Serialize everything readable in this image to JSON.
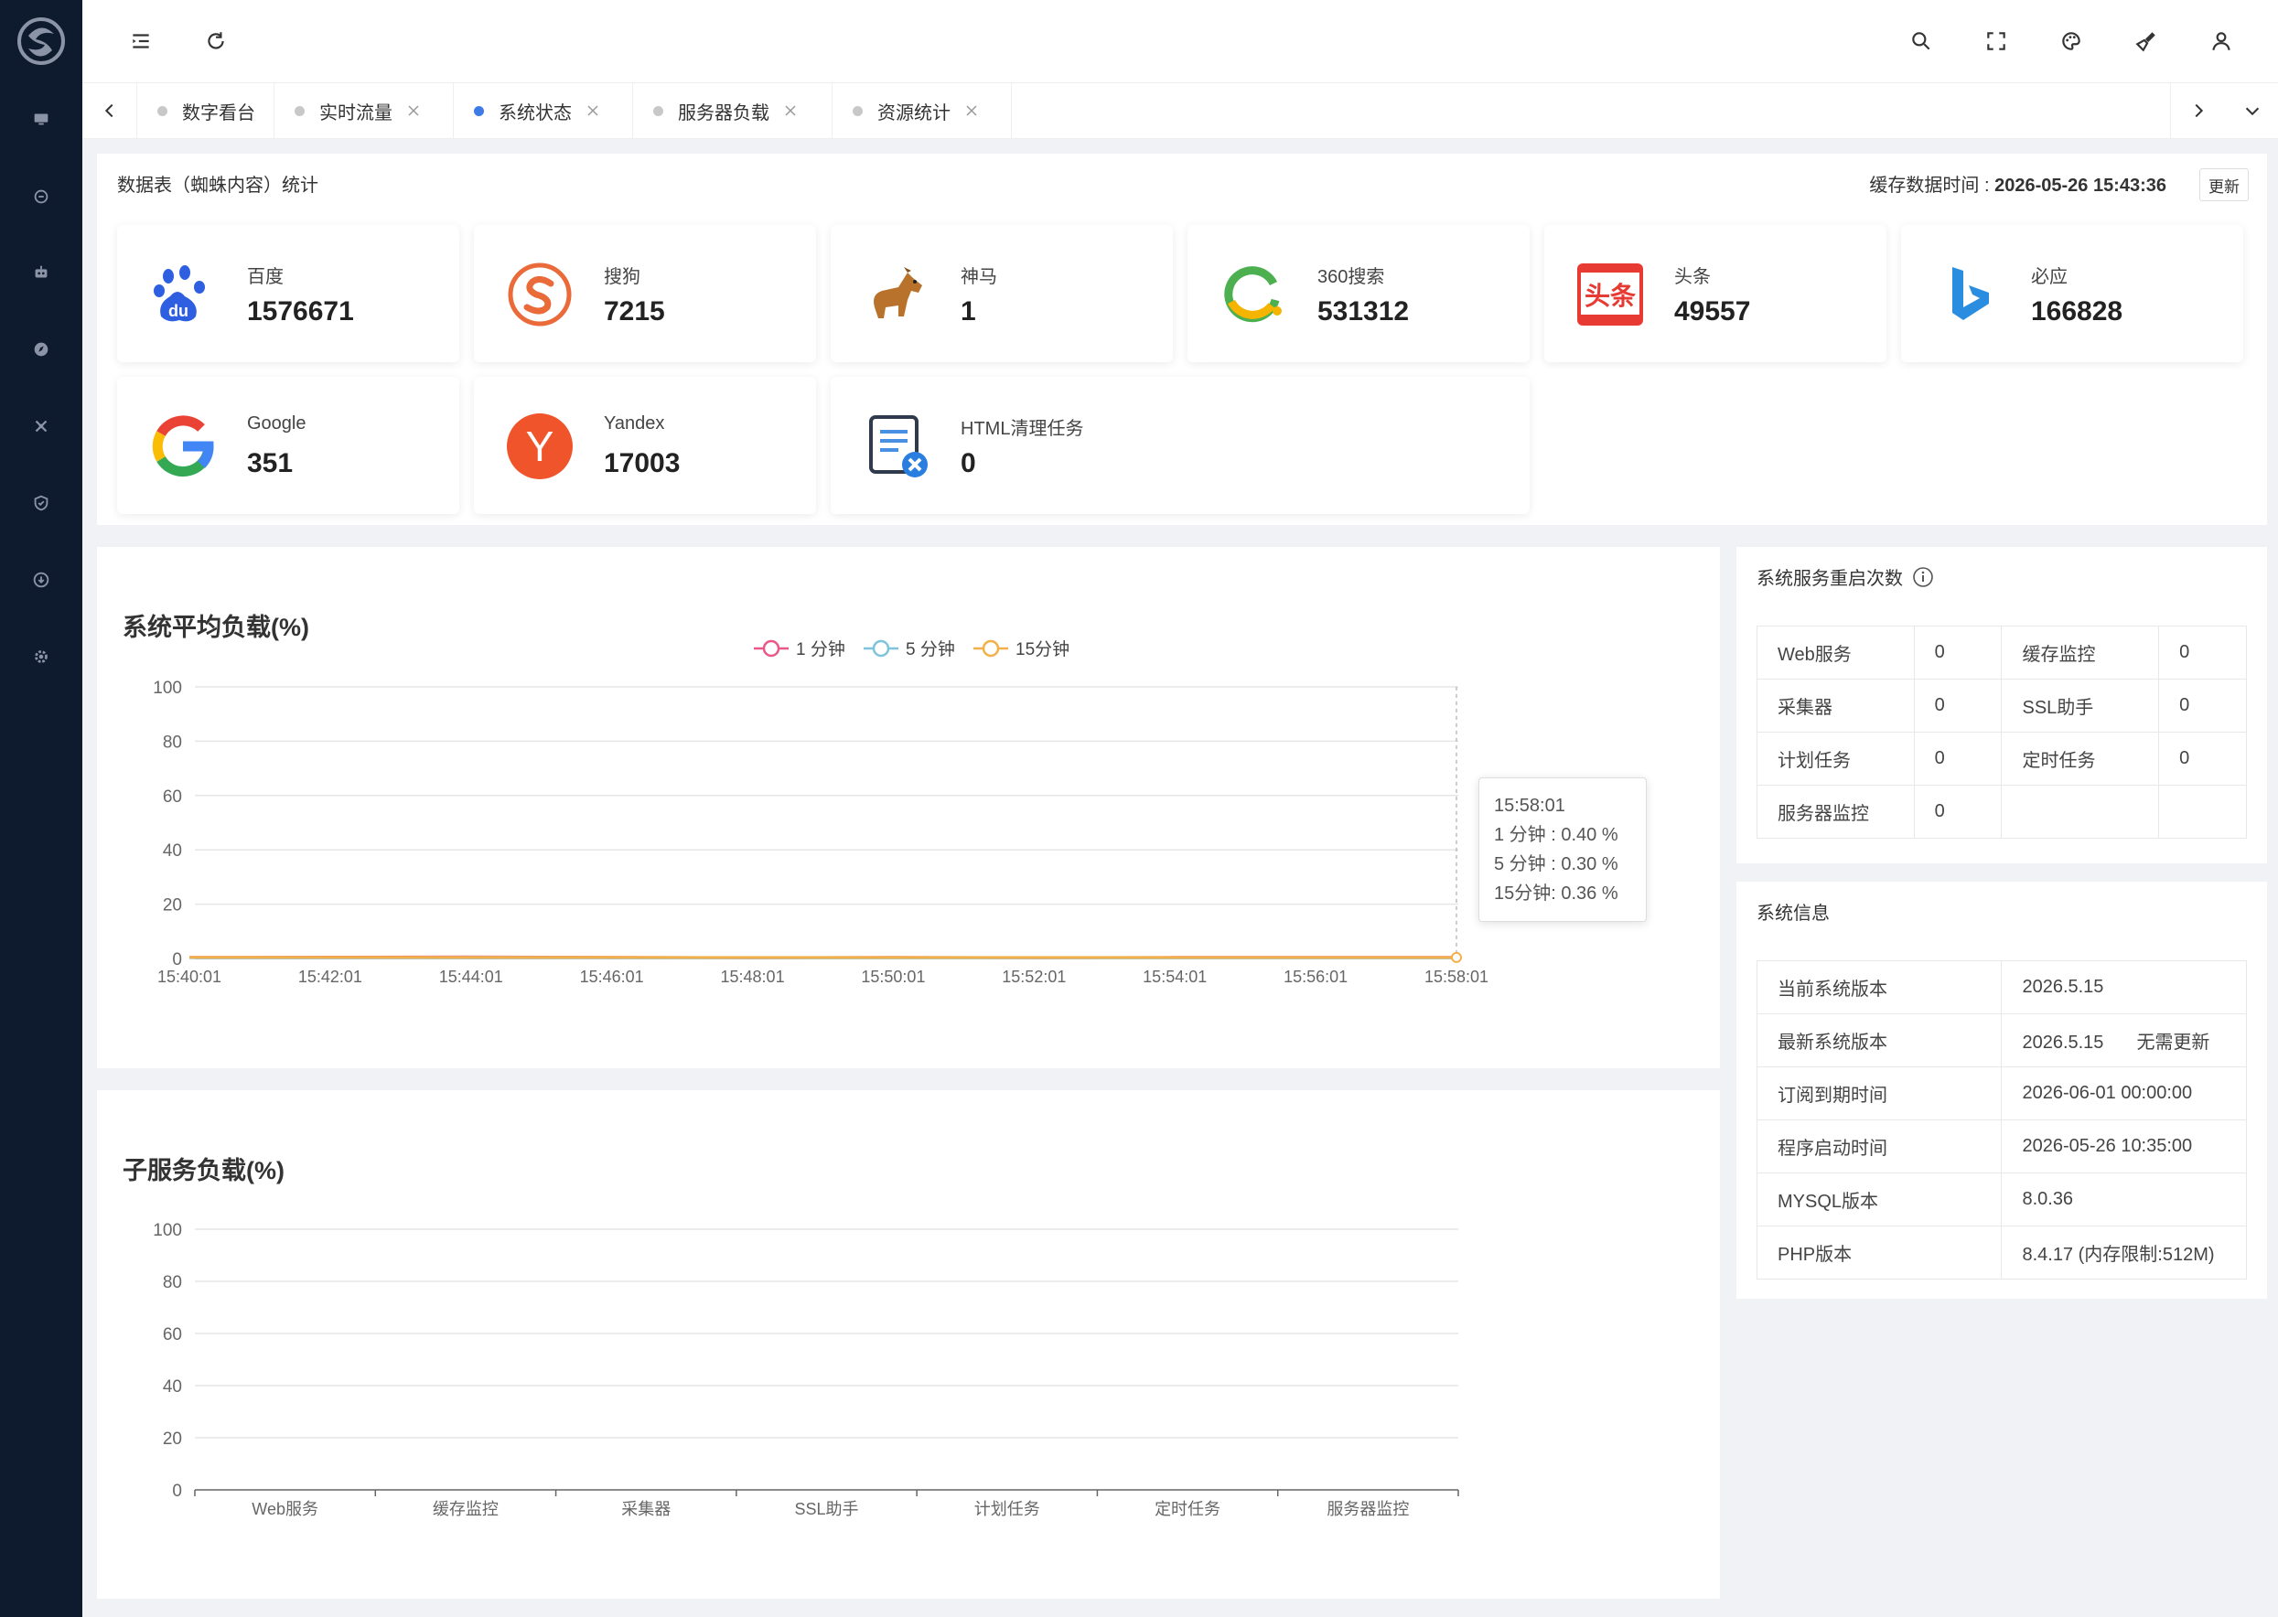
{
  "tabs": [
    {
      "label": "数字看台",
      "active": false,
      "closable": false
    },
    {
      "label": "实时流量",
      "active": false,
      "closable": true
    },
    {
      "label": "系统状态",
      "active": true,
      "closable": true
    },
    {
      "label": "服务器负载",
      "active": false,
      "closable": true
    },
    {
      "label": "资源统计",
      "active": false,
      "closable": true
    }
  ],
  "stats_panel": {
    "title": "数据表（蜘蛛内容）统计",
    "cache_label": "缓存数据时间 : ",
    "cache_time": "2026-05-26 15:43:36",
    "update_label": "更新",
    "cards": [
      {
        "name": "百度",
        "value": "1576671",
        "icon": "baidu-icon"
      },
      {
        "name": "搜狗",
        "value": "7215",
        "icon": "sogou-icon"
      },
      {
        "name": "神马",
        "value": "1",
        "icon": "shenma-icon"
      },
      {
        "name": "360搜索",
        "value": "531312",
        "icon": "so360-icon"
      },
      {
        "name": "头条",
        "value": "49557",
        "icon": "toutiao-icon",
        "icon_text": "头条"
      },
      {
        "name": "必应",
        "value": "166828",
        "icon": "bing-icon"
      },
      {
        "name": "Google",
        "value": "351",
        "icon": "google-icon"
      },
      {
        "name": "Yandex",
        "value": "17003",
        "icon": "yandex-icon",
        "icon_text": "Y"
      },
      {
        "name": "HTML清理任务",
        "value": "0",
        "icon": "html-clean-icon"
      }
    ]
  },
  "load_chart": {
    "title": "系统平均负载(%)",
    "tooltip": {
      "time": "15:58:01",
      "lines": [
        "1 分钟 : 0.40 %",
        "5 分钟 : 0.30 %",
        "15分钟: 0.36 %"
      ]
    }
  },
  "sub_chart": {
    "title": "子服务负载(%)"
  },
  "chart_data": [
    {
      "type": "line",
      "title": "系统平均负载(%)",
      "x": [
        "15:40:01",
        "15:42:01",
        "15:44:01",
        "15:46:01",
        "15:48:01",
        "15:50:01",
        "15:52:01",
        "15:54:01",
        "15:56:01",
        "15:58:01"
      ],
      "ylim": [
        0,
        100
      ],
      "yticks": [
        0,
        20,
        40,
        60,
        80,
        100
      ],
      "series": [
        {
          "name": "1 分钟",
          "color": "#e8588a",
          "values": [
            0.4,
            0.5,
            0.6,
            0.4,
            0.3,
            0.4,
            0.3,
            0.4,
            0.4,
            0.4
          ]
        },
        {
          "name": "5 分钟",
          "color": "#7fc4d8",
          "values": [
            0.3,
            0.3,
            0.4,
            0.3,
            0.3,
            0.3,
            0.3,
            0.3,
            0.3,
            0.3
          ]
        },
        {
          "name": "15分钟",
          "color": "#f2b04a",
          "values": [
            0.4,
            0.4,
            0.4,
            0.4,
            0.36,
            0.36,
            0.36,
            0.36,
            0.36,
            0.36
          ]
        }
      ],
      "legend": "top-center",
      "grid": true
    },
    {
      "type": "bar",
      "title": "子服务负载(%)",
      "categories": [
        "Web服务",
        "缓存监控",
        "采集器",
        "SSL助手",
        "计划任务",
        "定时任务",
        "服务器监控"
      ],
      "values": [
        0,
        0,
        0,
        0,
        0,
        0,
        0
      ],
      "ylim": [
        0,
        100
      ],
      "yticks": [
        0,
        20,
        40,
        60,
        80,
        100
      ],
      "grid": true
    }
  ],
  "restart_panel": {
    "title": "系统服务重启次数",
    "rows": [
      [
        {
          "k": "Web服务",
          "v": "0"
        },
        {
          "k": "缓存监控",
          "v": "0"
        }
      ],
      [
        {
          "k": "采集器",
          "v": "0"
        },
        {
          "k": "SSL助手",
          "v": "0"
        }
      ],
      [
        {
          "k": "计划任务",
          "v": "0"
        },
        {
          "k": "定时任务",
          "v": "0"
        }
      ],
      [
        {
          "k": "服务器监控",
          "v": "0"
        }
      ]
    ]
  },
  "sysinfo_panel": {
    "title": "系统信息",
    "rows": [
      {
        "k": "当前系统版本",
        "v": "2026.5.15",
        "extra": ""
      },
      {
        "k": "最新系统版本",
        "v": "2026.5.15",
        "extra": "无需更新"
      },
      {
        "k": "订阅到期时间",
        "v": "2026-06-01 00:00:00",
        "extra": ""
      },
      {
        "k": "程序启动时间",
        "v": "2026-05-26 10:35:00",
        "extra": ""
      },
      {
        "k": "MYSQL版本",
        "v": "8.0.36",
        "extra": ""
      },
      {
        "k": "PHP版本",
        "v": "8.4.17 (内存限制:512M)",
        "extra": ""
      }
    ]
  }
}
